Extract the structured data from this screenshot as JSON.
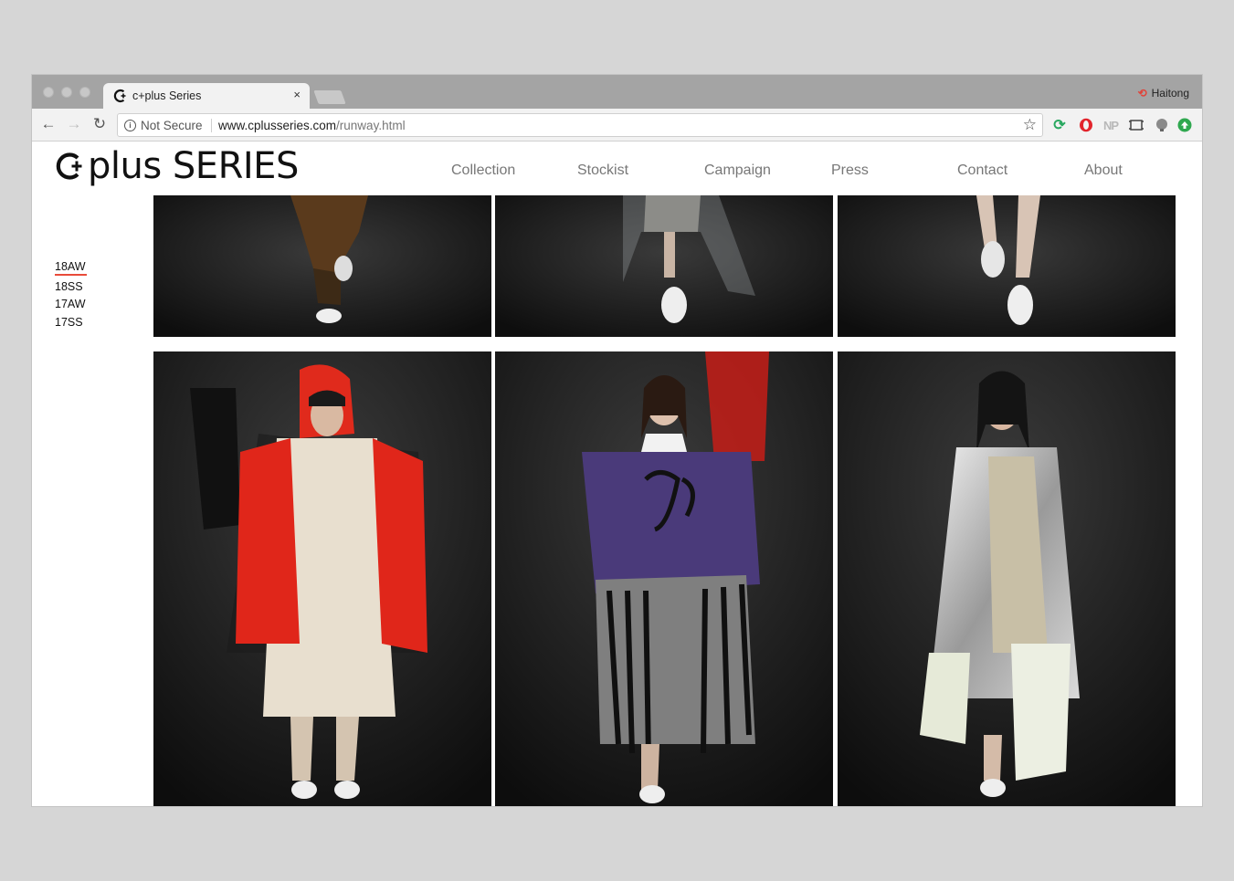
{
  "browser": {
    "tab_title": "c+plus Series",
    "tab_close": "×",
    "profile_name": "Haitong",
    "security_label": "Not Secure",
    "url_domain": "www.cplusseries.com",
    "url_path": "/runway.html",
    "ext_np_label": "NP"
  },
  "site": {
    "logo_text": "plus SERIES",
    "nav": [
      "Collection",
      "Stockist",
      "Campaign",
      "Press",
      "Contact",
      "About"
    ],
    "seasons": [
      "18AW",
      "18SS",
      "17AW",
      "17SS"
    ],
    "active_season": "18AW"
  },
  "colors": {
    "accent_underline": "#e84b3a",
    "nav_text": "#777777",
    "page_bg": "#ffffff"
  },
  "icons": {
    "back": "arrow-left-icon",
    "forward": "arrow-right-icon",
    "reload": "reload-icon",
    "info": "info-icon",
    "bookmark": "star-icon"
  },
  "runway_looks": [
    {
      "row": "top",
      "outfit": "brown trousers, white sneakers"
    },
    {
      "row": "top",
      "outfit": "grey skirt with clear vinyl overlay, white sneakers"
    },
    {
      "row": "top",
      "outfit": "bare legs, white sneakers"
    },
    {
      "row": "bottom",
      "outfit": "red glossy hooded jacket over beige trench coat"
    },
    {
      "row": "bottom",
      "outfit": "purple sweater with black fringe skirt"
    },
    {
      "row": "bottom",
      "outfit": "silver metallic trench coat with white skirt"
    }
  ]
}
